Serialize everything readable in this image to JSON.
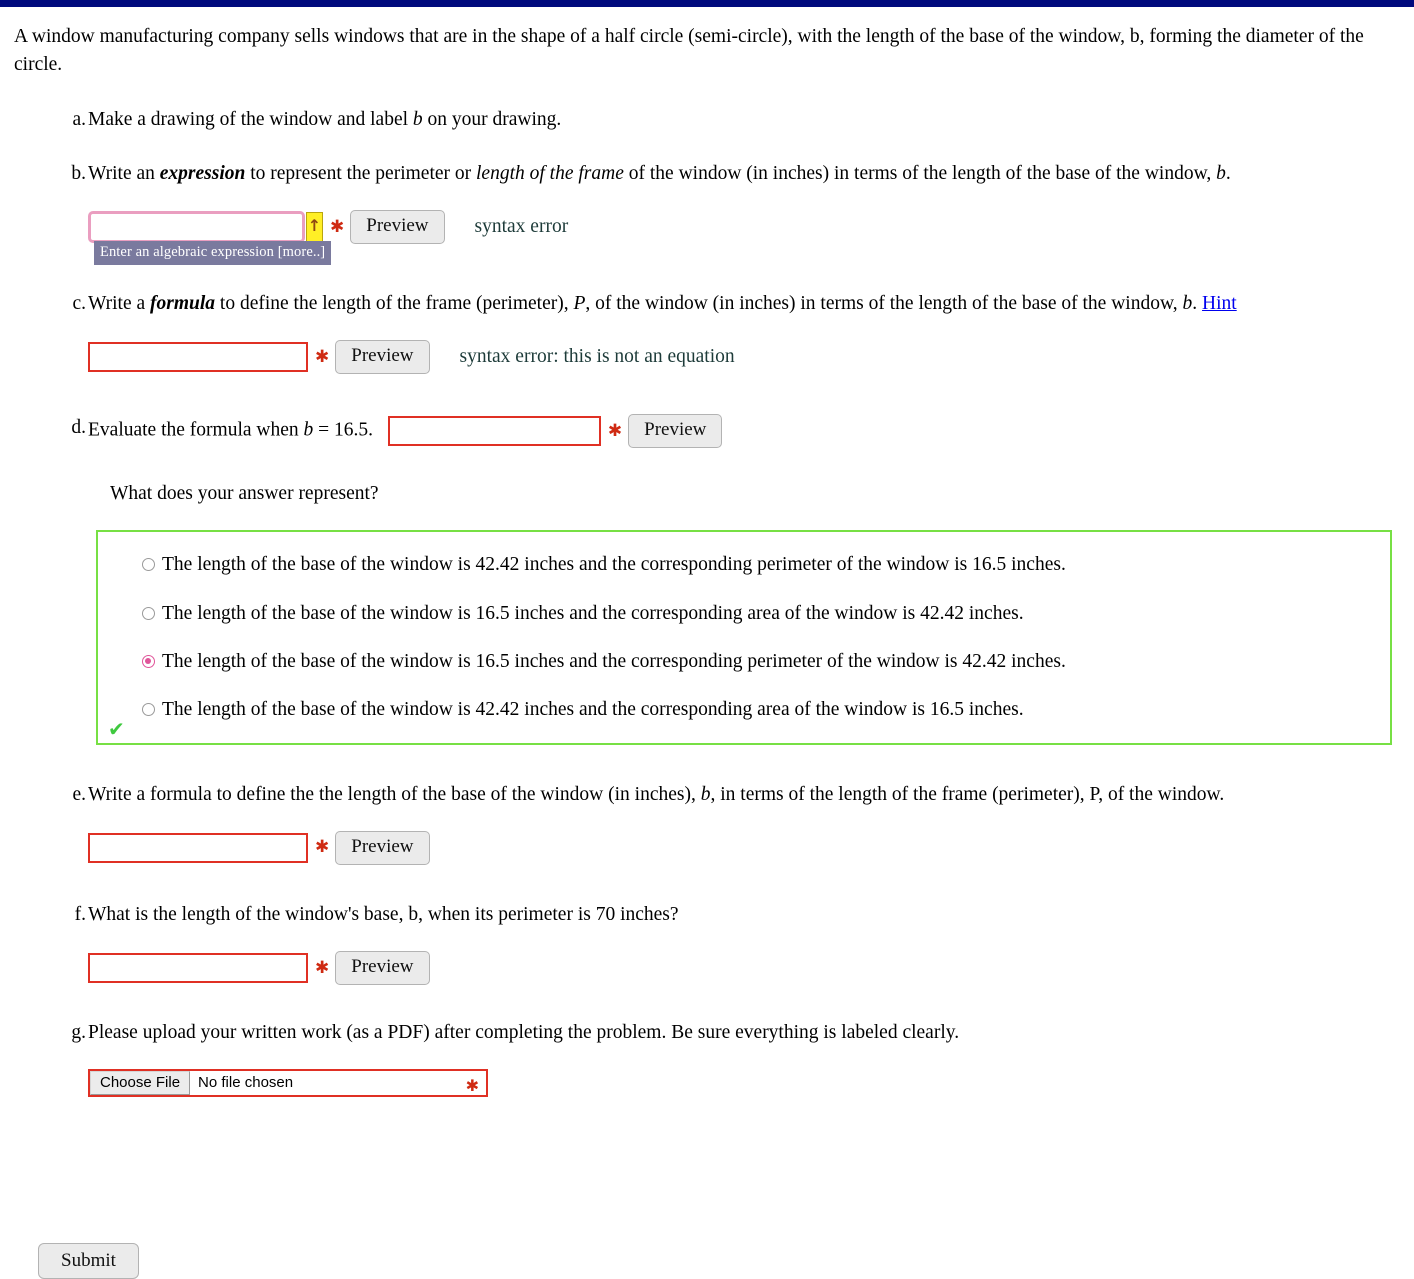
{
  "topbar": {
    "color": "#000a7d"
  },
  "intro": "A window manufacturing company sells windows that are in the shape of a half circle (semi-circle), with the length of the base of the window, b, forming the diameter of the circle.",
  "parts": {
    "a": {
      "marker": "a.",
      "text_1": "Make a drawing of the window and label ",
      "var": "b",
      "text_2": " on your drawing."
    },
    "b": {
      "marker": "b.",
      "text_1": "Write an ",
      "em_1": "expression",
      "text_2": " to represent the perimeter or ",
      "em_2": "length of the frame",
      "text_3": " of the window (in inches) in terms of the length of the base of the window, ",
      "var": "b",
      "text_4": ".",
      "input_value": "",
      "input_placeholder": "",
      "uparrow_glyph": "↑",
      "star_glyph": "✱",
      "preview_label": "Preview",
      "error_message": "syntax error",
      "tooltip": "Enter an algebraic expression [more..]"
    },
    "c": {
      "marker": "c.",
      "text_1": "Write a ",
      "em_1": "formula",
      "text_2": " to define the length of the frame (perimeter), ",
      "var_1": "P",
      "text_3": ", of the window (in inches) in terms of the length of the base of the window, ",
      "var_2": "b",
      "text_4": ". ",
      "hint_label": "Hint",
      "input_value": "",
      "star_glyph": "✱",
      "preview_label": "Preview",
      "error_message": "syntax error: this is not an equation"
    },
    "d": {
      "marker": "d.",
      "text_1": "Evaluate the formula when ",
      "var": "b",
      "equals": " = ",
      "value": "16.5",
      "text_2": ".",
      "input_value": "",
      "star_glyph": "✱",
      "preview_label": "Preview",
      "question": "What does your answer represent?",
      "options": [
        {
          "label": "The length of the base of the window is 42.42 inches and the corresponding perimeter of the window is 16.5 inches.",
          "selected": false
        },
        {
          "label": "The length of the base of the window is 16.5 inches and the corresponding area of the window is 42.42 inches.",
          "selected": false
        },
        {
          "label": "The length of the base of the window is 16.5 inches and the corresponding perimeter of the window is 42.42 inches.",
          "selected": true
        },
        {
          "label": "The length of the base of the window is 42.42 inches and the corresponding area of the window is 16.5 inches.",
          "selected": false
        }
      ],
      "correct_glyph": "✔",
      "box_border_color": "#77e044",
      "selected_radio_color": "#e0559a"
    },
    "e": {
      "marker": "e.",
      "text_1": "Write a formula to define the the length of the base of the window (in inches), ",
      "var_1": "b",
      "text_2": ", in terms of the length of the frame (perimeter), P, of the window.",
      "input_value": "",
      "star_glyph": "✱",
      "preview_label": "Preview"
    },
    "f": {
      "marker": "f.",
      "text_1": "What is the length of the window's base, b, when its perimeter is 70 inches?",
      "input_value": "",
      "star_glyph": "✱",
      "preview_label": "Preview"
    },
    "g": {
      "marker": "g.",
      "text_1": "Please upload your written work (as a PDF) after completing the problem. Be sure everything is labeled clearly.",
      "choose_file_label": "Choose File",
      "no_file_label": "No file chosen",
      "star_glyph": "✱"
    }
  },
  "footer": {
    "submit_label": "Submit"
  }
}
